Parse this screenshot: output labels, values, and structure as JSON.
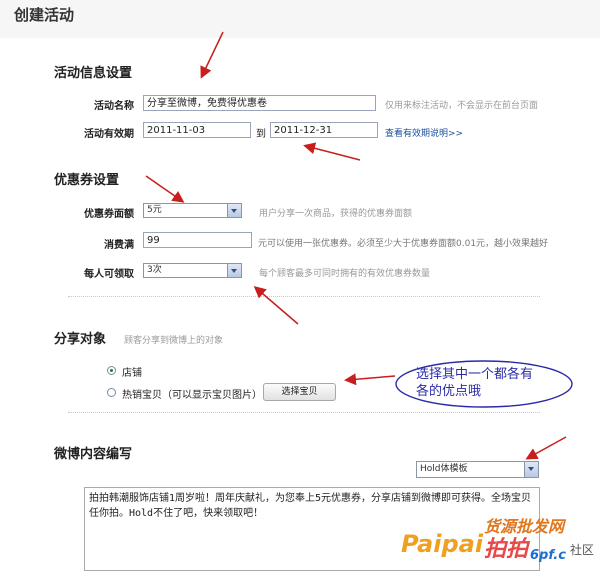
{
  "page": {
    "title": "创建活动"
  },
  "activity_info": {
    "section_title": "活动信息设置",
    "name_label": "活动名称",
    "name_value": "分享至微博，免费得优惠卷",
    "name_hint": "仅用来标注活动，不会显示在前台页面",
    "period_label": "活动有效期",
    "start_date": "2011-11-03",
    "date_sep": "到",
    "end_date": "2011-12-31",
    "period_link": "查看有效期说明>>"
  },
  "coupon": {
    "section_title": "优惠券设置",
    "denomination_label": "优惠券面额",
    "denomination_value": "5元",
    "denomination_hint": "用户分享一次商品，获得的优惠券面额",
    "min_spend_label": "消费满",
    "min_spend_value": "99",
    "min_spend_hint": "元可以使用一张优惠券。必须至少大于优惠券面额0.01元，越小效果越好",
    "per_user_label": "每人可领取",
    "per_user_value": "3次",
    "per_user_hint": "每个顾客最多可同时拥有的有效优惠券数量"
  },
  "share_target": {
    "section_title": "分享对象",
    "section_hint": "顾客分享到微博上的对象",
    "option_shop": "店铺",
    "option_items": "热销宝贝（可以显示宝贝图片）",
    "choose_button": "选择宝贝"
  },
  "callout": {
    "line1": "选择其中一个都各有",
    "line2": "各的优点哦"
  },
  "weibo": {
    "section_title": "微博内容编写",
    "template_value": "Hold体模板",
    "content": "拍拍韩潮服饰店铺1周岁啦！周年庆献礼，为您奉上5元优惠券，分享店铺到微博即可获得。全场宝贝任你拍。Hold不住了吧，快来领取吧！"
  },
  "watermark": {
    "top": "货源批发网",
    "brand": "Paipai",
    "brand2": "拍拍",
    "site": "6pf.c",
    "suffix": "社区"
  },
  "colors": {
    "arrow": "#c81e1e",
    "callout_border": "#2a2aa8",
    "link": "#1a4e9c"
  }
}
